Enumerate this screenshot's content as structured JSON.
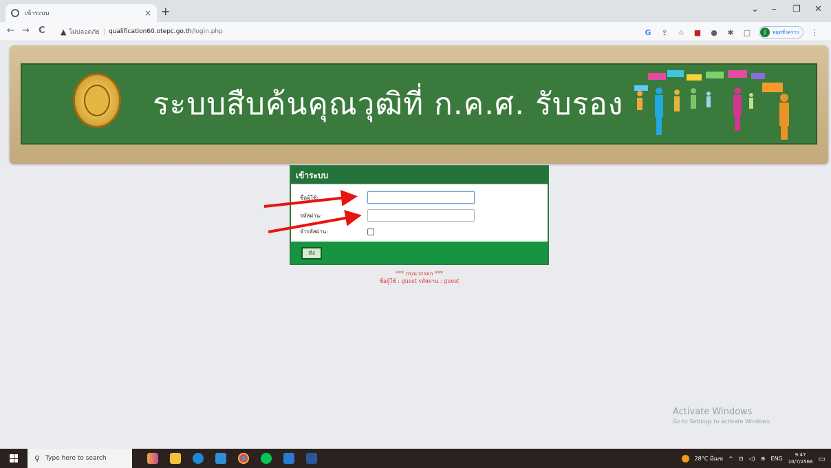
{
  "browser": {
    "tab_title": "เข้าระบบ",
    "tab_close": "×",
    "new_tab": "+",
    "win_dropdown": "⌄",
    "win_minimize": "–",
    "win_restore": "❐",
    "win_close": "✕",
    "back": "←",
    "forward": "→",
    "reload": "C",
    "security_warning": "ไม่ปลอดภัย",
    "url_host": "qualification60.otepc.go.th",
    "url_path": "/login.php",
    "profile_initial": "J",
    "profile_name": "หยุดชั่วคราว",
    "menu": "⋮"
  },
  "banner": {
    "title": "ระบบสืบค้นคุณวุฒิที่ ก.ค.ศ. รับรอง"
  },
  "login": {
    "header": "เข้าระบบ",
    "username_label": "ชื่อผู้ใช้:",
    "username_value": "",
    "password_label": "รหัสผ่าน:",
    "password_value": "",
    "remember_label": "จำรหัสผ่าน:",
    "remember_checked": false,
    "submit_label": "ส่ง"
  },
  "hint": {
    "line1": "*** กรุณากรอก ***",
    "line2": "ชื่อผู้ใช้ : guest   รหัสผ่าน : guest"
  },
  "watermark": {
    "title": "Activate Windows",
    "subtitle": "Go to Settings to activate Windows."
  },
  "taskbar": {
    "search_placeholder": "Type here to search",
    "weather": "28°C มีเมฆ",
    "language": "ENG",
    "time": "9:47",
    "date": "10/7/2566"
  },
  "colors": {
    "banner_green": "#3a7a3c",
    "login_header": "#24733a",
    "login_footer": "#169440",
    "hint_red": "#e53935",
    "arrow_red": "#e8140e"
  }
}
